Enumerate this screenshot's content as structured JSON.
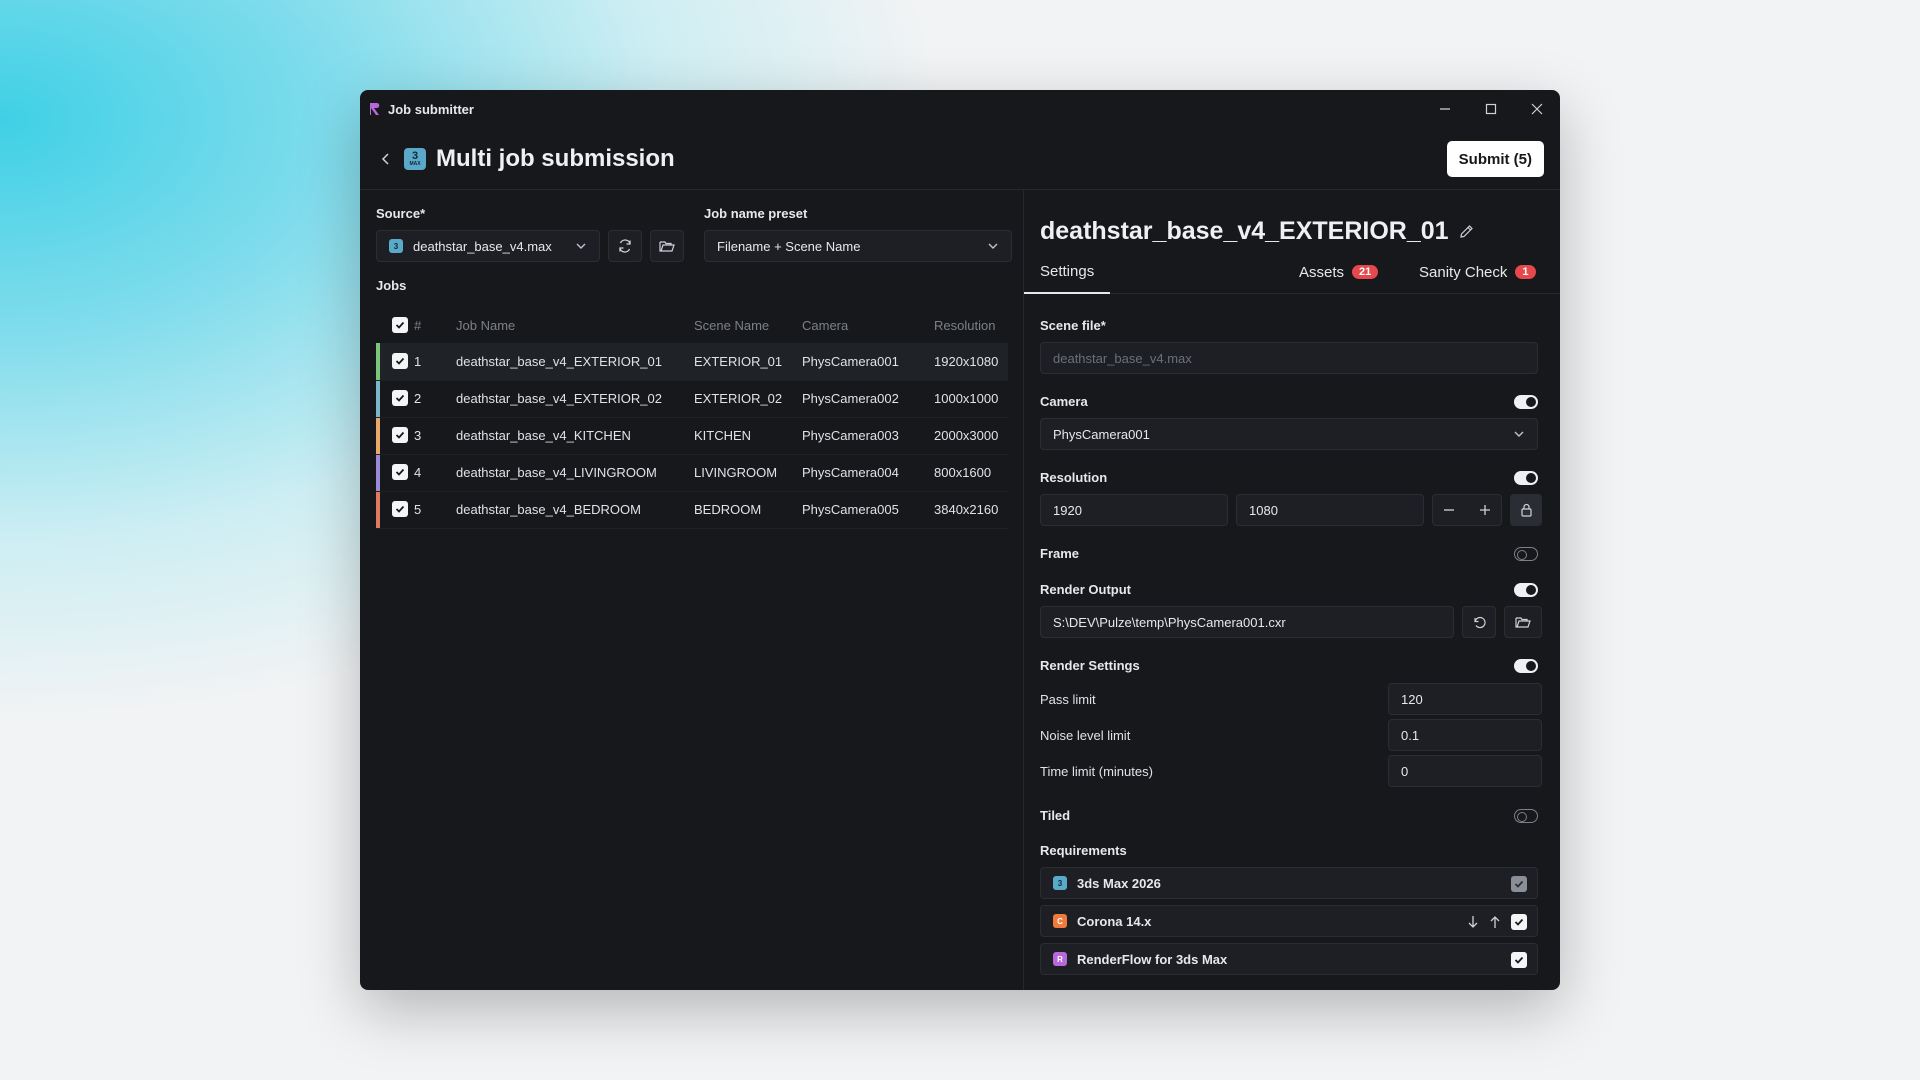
{
  "window": {
    "title": "Job submitter"
  },
  "header": {
    "badge_main": "3",
    "badge_sub": "MAX",
    "title": "Multi job submission",
    "submit_label": "Submit (5)"
  },
  "left": {
    "source_label": "Source*",
    "source_value": "deathstar_base_v4.max",
    "preset_label": "Job name preset",
    "preset_value": "Filename + Scene Name",
    "jobs_label": "Jobs",
    "columns": [
      "#",
      "Job Name",
      "Scene Name",
      "Camera",
      "Resolution"
    ],
    "jobs": [
      {
        "num": "1",
        "name": "deathstar_base_v4_EXTERIOR_01",
        "scene": "EXTERIOR_01",
        "camera": "PhysCamera001",
        "resolution": "1920x1080",
        "color": "#7ac77a"
      },
      {
        "num": "2",
        "name": "deathstar_base_v4_EXTERIOR_02",
        "scene": "EXTERIOR_02",
        "camera": "PhysCamera002",
        "resolution": "1000x1000",
        "color": "#7ab8c7"
      },
      {
        "num": "3",
        "name": "deathstar_base_v4_KITCHEN",
        "scene": "KITCHEN",
        "camera": "PhysCamera003",
        "resolution": "2000x3000",
        "color": "#e8a96b"
      },
      {
        "num": "4",
        "name": "deathstar_base_v4_LIVINGROOM",
        "scene": "LIVINGROOM",
        "camera": "PhysCamera004",
        "resolution": "800x1600",
        "color": "#9b8ad6"
      },
      {
        "num": "5",
        "name": "deathstar_base_v4_BEDROOM",
        "scene": "BEDROOM",
        "camera": "PhysCamera005",
        "resolution": "3840x2160",
        "color": "#e07a5f"
      }
    ]
  },
  "detail": {
    "title": "deathstar_base_v4_EXTERIOR_01",
    "tabs": {
      "settings": "Settings",
      "assets": "Assets",
      "assets_count": "21",
      "sanity": "Sanity Check",
      "sanity_count": "1"
    },
    "scene_file_label": "Scene file*",
    "scene_file_value": "deathstar_base_v4.max",
    "camera_label": "Camera",
    "camera_value": "PhysCamera001",
    "resolution_label": "Resolution",
    "res_width": "1920",
    "res_height": "1080",
    "frame_label": "Frame",
    "render_output_label": "Render Output",
    "render_output_value": "S:\\DEV\\Pulze\\temp\\PhysCamera001.cxr",
    "render_settings_label": "Render Settings",
    "pass_limit_label": "Pass limit",
    "pass_limit_value": "120",
    "noise_label": "Noise level limit",
    "noise_value": "0.1",
    "time_label": "Time limit (minutes)",
    "time_value": "0",
    "tiled_label": "Tiled",
    "requirements_label": "Requirements",
    "requirements": [
      {
        "name": "3ds Max 2026",
        "icon_color": "#5aa9c9",
        "glyph": "3"
      },
      {
        "name": "Corona 14.x",
        "icon_color": "#f07a3c",
        "glyph": "C"
      },
      {
        "name": "RenderFlow for 3ds Max",
        "icon_color": "#b868d8",
        "glyph": "R"
      }
    ]
  },
  "colors": {
    "background": "#17181c",
    "accent_badge": "#e5484d"
  }
}
